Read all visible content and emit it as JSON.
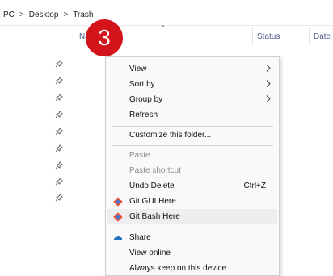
{
  "breadcrumb": {
    "items": [
      "PC",
      "Desktop",
      "Trash"
    ],
    "separator": ">"
  },
  "columns": {
    "name": "Na",
    "status": "Status",
    "date": "Date"
  },
  "badge": {
    "number": "3",
    "color": "#d3141b"
  },
  "context_menu": {
    "items": [
      {
        "label": "View",
        "submenu": true
      },
      {
        "label": "Sort by",
        "submenu": true
      },
      {
        "label": "Group by",
        "submenu": true
      },
      {
        "label": "Refresh"
      },
      {
        "label": "Customize this folder..."
      },
      {
        "label": "Paste",
        "disabled": true
      },
      {
        "label": "Paste shortcut",
        "disabled": true
      },
      {
        "label": "Undo Delete",
        "shortcut": "Ctrl+Z"
      },
      {
        "label": "Git GUI Here",
        "icon": "git-icon"
      },
      {
        "label": "Git Bash Here",
        "icon": "git-icon"
      },
      {
        "label": "Share",
        "icon": "onedrive-cloud-icon"
      },
      {
        "label": "View online"
      },
      {
        "label": "Always keep on this device"
      }
    ]
  }
}
